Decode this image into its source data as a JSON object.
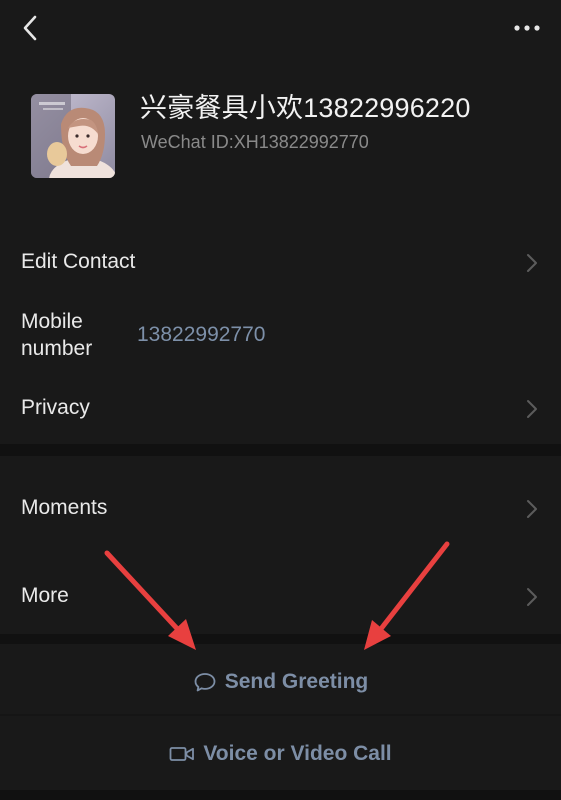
{
  "header": {
    "back_icon": "chevron-left-icon",
    "more_icon": "ellipsis-icon"
  },
  "profile": {
    "name": "兴豪餐具小欢13822996220",
    "wechat_id": "WeChat ID:XH13822992770"
  },
  "rows": {
    "edit_contact": "Edit Contact",
    "mobile_label": "Mobile number",
    "mobile_value": "13822992770",
    "privacy": "Privacy",
    "moments": "Moments",
    "more": "More"
  },
  "actions": {
    "send_greeting": "Send Greeting",
    "send_greeting_icon": "chat-bubble-icon",
    "voice_video_call": "Voice or Video Call",
    "voice_video_icon": "video-camera-icon"
  },
  "colors": {
    "background": "#191919",
    "separator": "#111111",
    "link_blue": "#7d90a9",
    "annotation_arrow": "#e8403f"
  }
}
